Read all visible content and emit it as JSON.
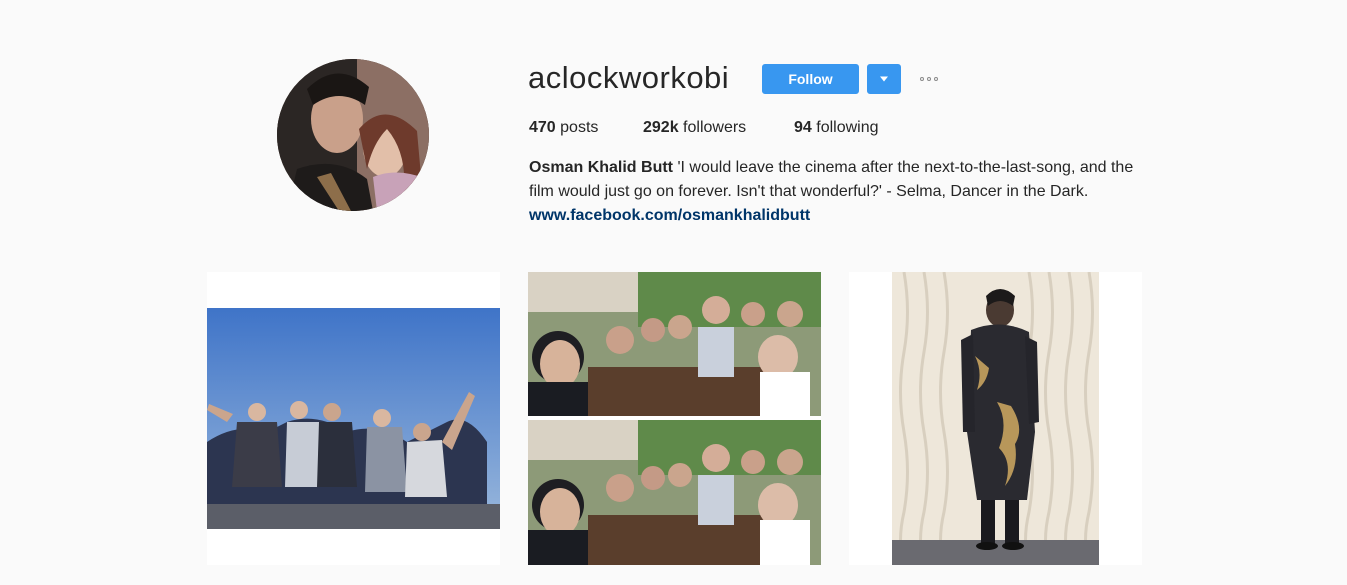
{
  "profile": {
    "username": "aclockworkobi",
    "follow_label": "Follow",
    "dropdown_icon": "caret-down-icon",
    "more_icon": "more-options-icon",
    "stats": {
      "posts_count": "470",
      "posts_label": " posts",
      "followers_count": "292k",
      "followers_label": " followers",
      "following_count": "94",
      "following_label": " following"
    },
    "bio": {
      "full_name": "Osman Khalid Butt",
      "text": " 'I would leave the cinema after the next-to-the-last-song, and the film would just go on forever. Isn't that wonderful?' - Selma, Dancer in the Dark.",
      "link": "www.facebook.com/osmankhalidbutt"
    }
  },
  "colors": {
    "accent": "#3897f0",
    "link": "#003569",
    "background": "#fafafa",
    "text": "#262626"
  }
}
